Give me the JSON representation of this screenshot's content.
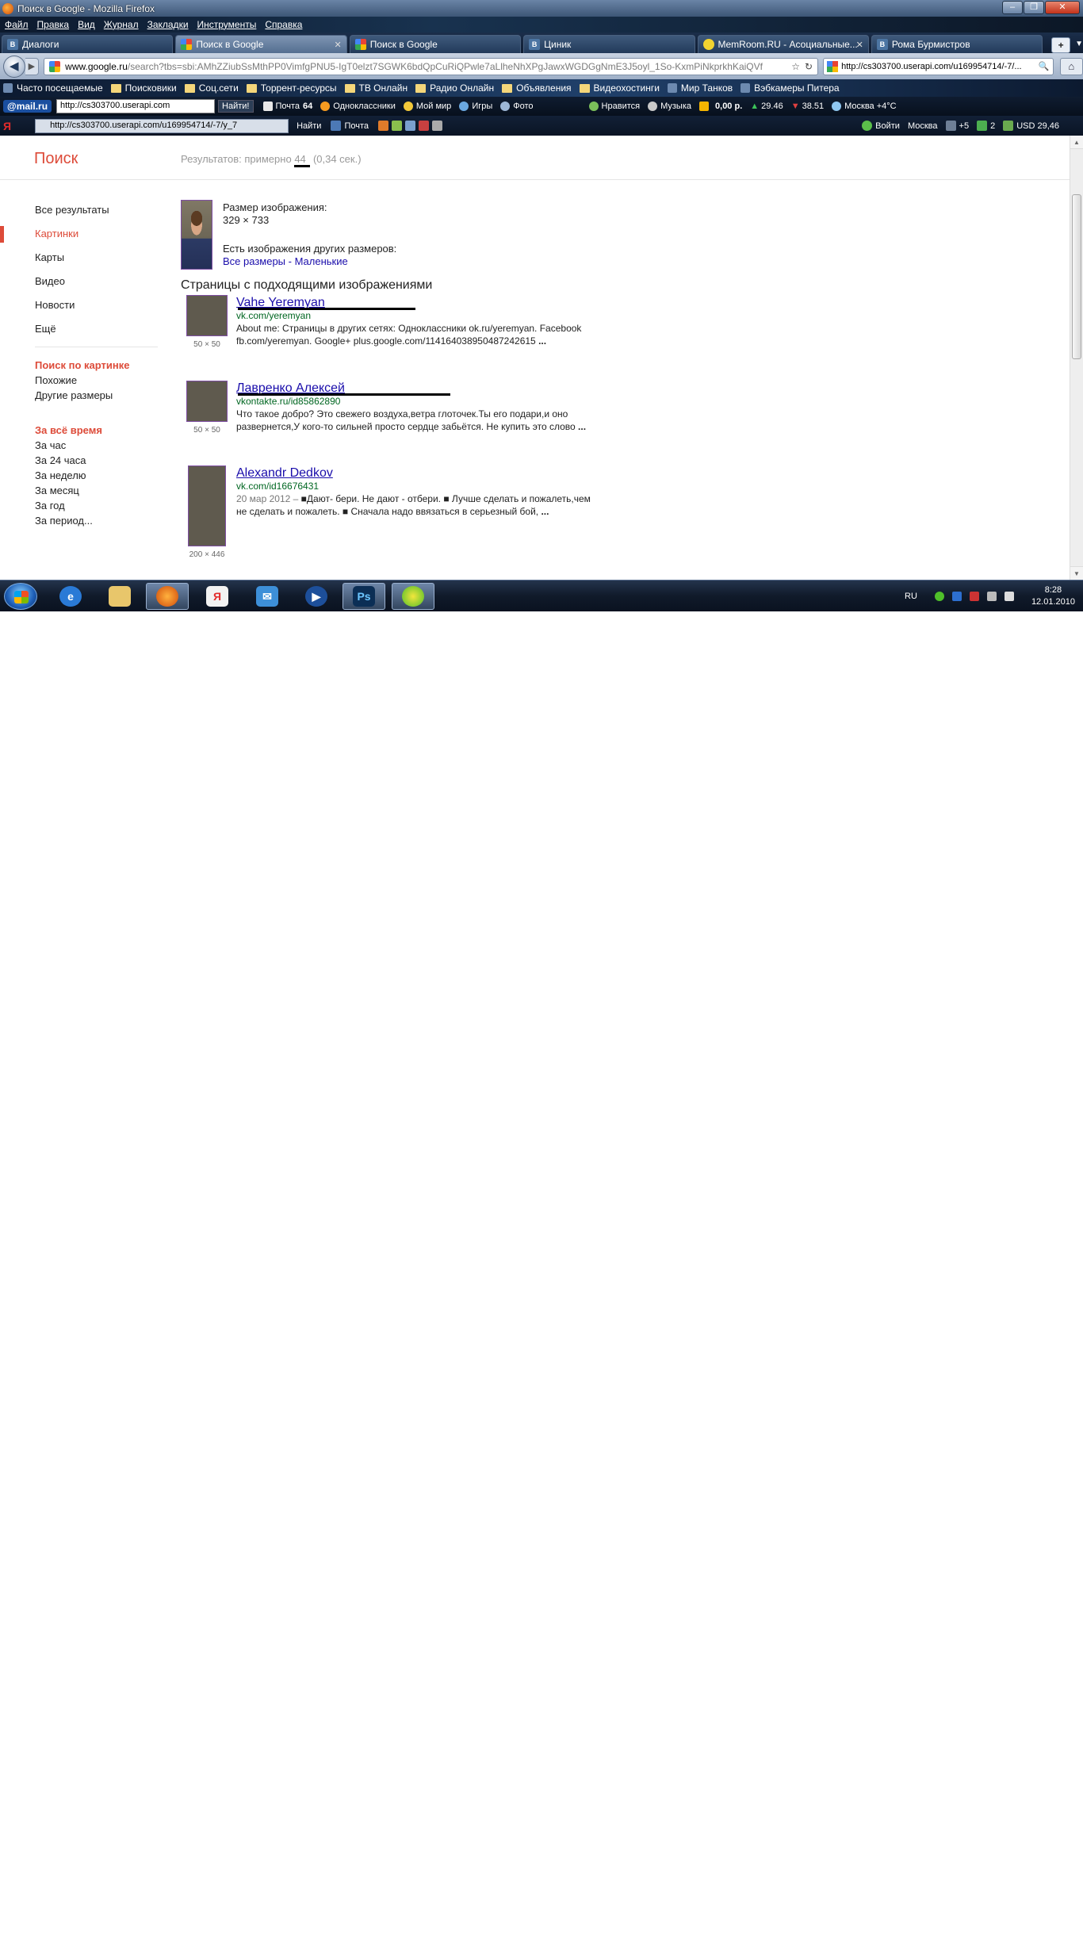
{
  "window": {
    "title": "Поиск в Google - Mozilla Firefox"
  },
  "menubar": [
    "Файл",
    "Правка",
    "Вид",
    "Журнал",
    "Закладки",
    "Инструменты",
    "Справка"
  ],
  "tabs": [
    {
      "label": "Диалоги",
      "icon": "vk-icon"
    },
    {
      "label": "Поиск в Google",
      "icon": "google-icon",
      "active": true
    },
    {
      "label": "Поиск в Google",
      "icon": "google-icon"
    },
    {
      "label": "Циник",
      "icon": "vk-icon"
    },
    {
      "label": "MemRoom.RU - Асоциальные...",
      "icon": "memroom-icon"
    },
    {
      "label": "Рома Бурмистров",
      "icon": "vk-icon"
    }
  ],
  "navbar": {
    "url_domain": "www.google.ru",
    "url_rest": "/search?tbs=sbi:AMhZZiubSsMthPP0VimfgPNU5-IgT0elzt7SGWK6bdQpCuRiQPwle7aLlheNhXPgJawxWGDGgNmE3J5oyl_1So-KxmPiNkprkhKaiQVf",
    "search_value": "http://cs303700.userapi.com/u169954714/-7/..."
  },
  "bookmarks": [
    "Часто посещаемые",
    "Поисковики",
    "Соц.сети",
    "Торрент-ресурсы",
    "ТВ Онлайн",
    "Радио Онлайн",
    "Объявления",
    "Видеохостинги",
    "Мир Танков",
    "Вэбкамеры Питера"
  ],
  "mailru": {
    "logo": "@mail.ru",
    "field": "http://cs303700.userapi.com",
    "go": "Найти!",
    "mail": "Почта",
    "mail_count": "64",
    "items": [
      "Одноклассники",
      "Мой мир",
      "Игры",
      "Фото",
      "Нравится",
      "Музыка"
    ],
    "balance": "0,00 р.",
    "rate1": "29.46",
    "rate2": "38.51",
    "weather": "Москва +4°C"
  },
  "yandex": {
    "logo": "Я",
    "field": "http://cs303700.userapi.com/u169954714/-7/y_7",
    "find": "Найти",
    "mail": "Почта",
    "login": "Войти",
    "city": "Москва",
    "traffic": "+5",
    "count": "2",
    "usd": "USD 29,46"
  },
  "google": {
    "logo": "Поиск",
    "stats_prefix": "Результатов: примерно",
    "stats_count": "44",
    "stats_suffix": "(0,34 сек.)",
    "sidebar": {
      "nav": [
        "Все результаты",
        "Картинки",
        "Карты",
        "Видео",
        "Новости",
        "Ещё"
      ],
      "search_by_image_head": "Поиск по картинке",
      "search_by_image_links": [
        "Похожие",
        "Другие размеры"
      ],
      "time_head": "За всё время",
      "time_links": [
        "За час",
        "За 24 часа",
        "За неделю",
        "За месяц",
        "За год",
        "За период..."
      ]
    },
    "image_info": {
      "size_label": "Размер изображения:",
      "size_value": "329 × 733",
      "other_label": "Есть изображения других размеров:",
      "other_links": "Все размеры - Маленькие"
    },
    "section_title": "Страницы с подходящими изображениями",
    "results": [
      {
        "title": "Vahe Yeremyan",
        "url": "vk.com/yeremyan",
        "desc": "About me: Страницы в других сетях: Одноклассники ok.ru/yeremyan. Facebook fb.com/yeremyan. Google+ plus.google.com/114164038950487242615",
        "ellipsis": "...",
        "dims": "50 × 50"
      },
      {
        "title": "Лавренко Алексей",
        "url": "vkontakte.ru/id85862890",
        "desc": "Что такое добро? Это свежего воздуха,ветра глоточек.Ты его подари,и оно развернется,У кого-то сильней просто сердце забьётся. Не купить это слово",
        "ellipsis": "...",
        "dims": "50 × 50"
      },
      {
        "title": "Alexandr Dedkov",
        "url": "vk.com/id16676431",
        "date": "20 мар 2012 –",
        "desc": "■Дают- бери. Не дают - отбери. ■ Лучше сделать и пожалеть,чем не сделать и пожалеть. ■ Сначала надо ввязаться в серьезный бой,",
        "ellipsis": "...",
        "dims": "200 × 446"
      }
    ]
  },
  "taskbar": {
    "apps": [
      "internet-explorer",
      "explorer",
      "firefox",
      "yandex",
      "mail",
      "media-player",
      "photoshop",
      "icq"
    ],
    "lang": "RU",
    "time": "8:28",
    "date": "12.01.2010"
  }
}
